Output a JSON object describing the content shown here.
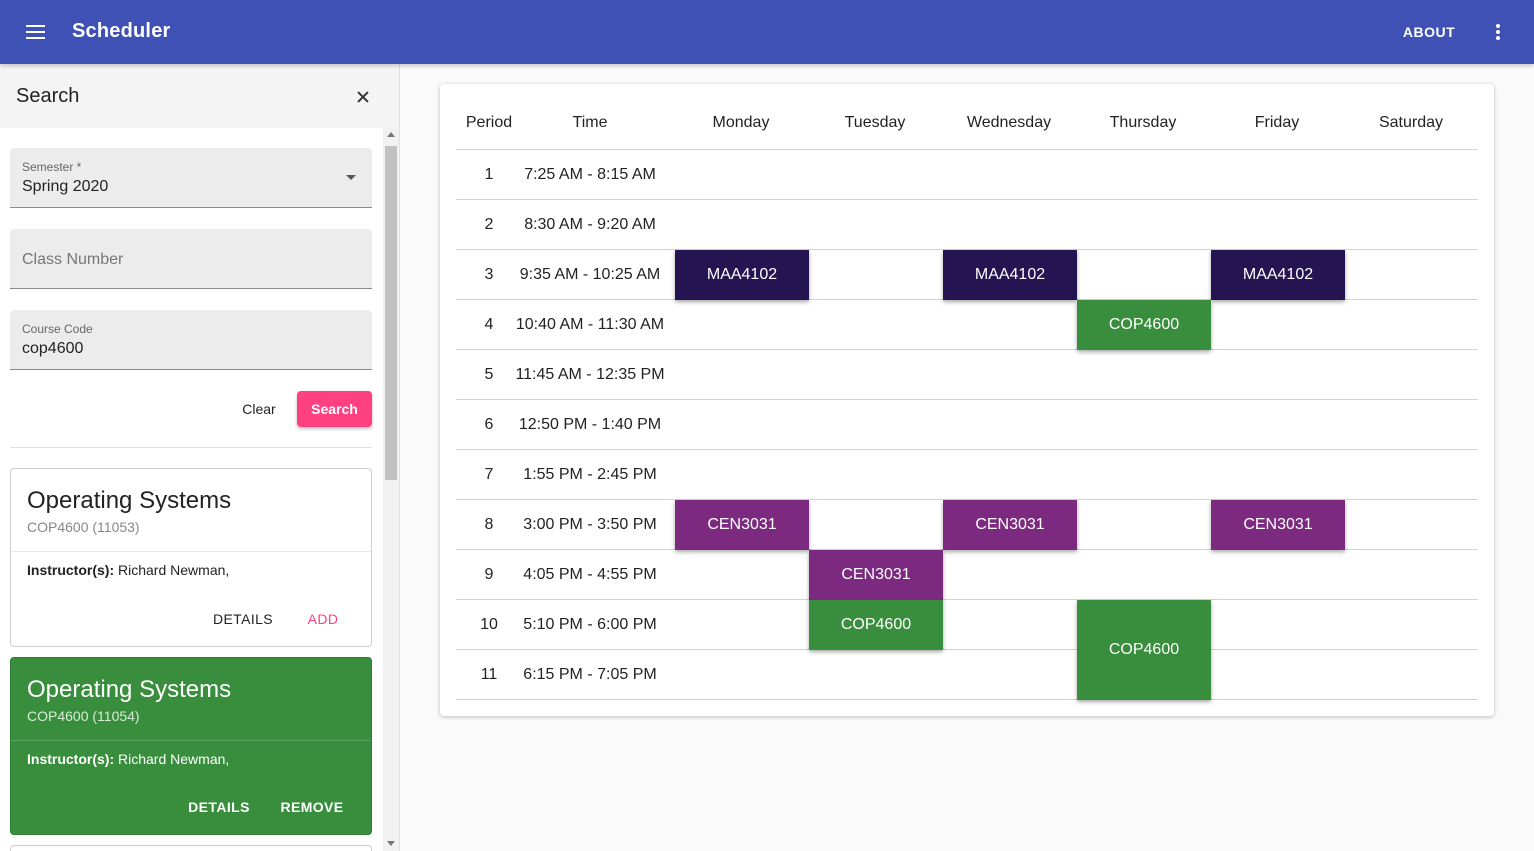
{
  "app": {
    "title": "Scheduler",
    "about_label": "ABOUT"
  },
  "sidebar": {
    "title": "Search",
    "semester": {
      "label": "Semester *",
      "value": "Spring 2020"
    },
    "class_number": {
      "placeholder": "Class Number"
    },
    "course_code": {
      "label": "Course Code",
      "value": "cop4600"
    },
    "clear_label": "Clear",
    "search_label": "Search",
    "results": [
      {
        "title": "Operating Systems",
        "code": "COP4600 (11053)",
        "instructor_label": "Instructor(s):",
        "instructor": " Richard Newman,",
        "details_label": "DETAILS",
        "action_label": "ADD"
      },
      {
        "title": "Operating Systems",
        "code": "COP4600 (11054)",
        "instructor_label": "Instructor(s):",
        "instructor": " Richard Newman,",
        "details_label": "DETAILS",
        "action_label": "REMOVE"
      }
    ]
  },
  "timetable": {
    "headers": [
      "Period",
      "Time",
      "Monday",
      "Tuesday",
      "Wednesday",
      "Thursday",
      "Friday",
      "Saturday"
    ],
    "periods": [
      {
        "period": "1",
        "time": "7:25 AM - 8:15 AM"
      },
      {
        "period": "2",
        "time": "8:30 AM - 9:20 AM"
      },
      {
        "period": "3",
        "time": "9:35 AM - 10:25 AM"
      },
      {
        "period": "4",
        "time": "10:40 AM - 11:30 AM"
      },
      {
        "period": "5",
        "time": "11:45 AM - 12:35 PM"
      },
      {
        "period": "6",
        "time": "12:50 PM - 1:40 PM"
      },
      {
        "period": "7",
        "time": "1:55 PM - 2:45 PM"
      },
      {
        "period": "8",
        "time": "3:00 PM - 3:50 PM"
      },
      {
        "period": "9",
        "time": "4:05 PM - 4:55 PM"
      },
      {
        "period": "10",
        "time": "5:10 PM - 6:00 PM"
      },
      {
        "period": "11",
        "time": "6:15 PM - 7:05 PM"
      }
    ],
    "blocks": [
      {
        "label": "MAA4102",
        "day": "Monday",
        "period": 3,
        "span": 1,
        "color": "#241552"
      },
      {
        "label": "MAA4102",
        "day": "Wednesday",
        "period": 3,
        "span": 1,
        "color": "#241552"
      },
      {
        "label": "MAA4102",
        "day": "Friday",
        "period": 3,
        "span": 1,
        "color": "#241552"
      },
      {
        "label": "COP4600",
        "day": "Thursday",
        "period": 4,
        "span": 1,
        "color": "#388e3c"
      },
      {
        "label": "CEN3031",
        "day": "Monday",
        "period": 8,
        "span": 1,
        "color": "#7b2a7f"
      },
      {
        "label": "CEN3031",
        "day": "Wednesday",
        "period": 8,
        "span": 1,
        "color": "#7b2a7f"
      },
      {
        "label": "CEN3031",
        "day": "Friday",
        "period": 8,
        "span": 1,
        "color": "#7b2a7f"
      },
      {
        "label": "CEN3031",
        "day": "Tuesday",
        "period": 9,
        "span": 1,
        "color": "#7b2a7f"
      },
      {
        "label": "COP4600",
        "day": "Tuesday",
        "period": 10,
        "span": 1,
        "color": "#388e3c"
      },
      {
        "label": "COP4600",
        "day": "Thursday",
        "period": 10,
        "span": 2,
        "color": "#388e3c"
      }
    ]
  },
  "colors": {
    "primary": "#3f51b5",
    "accent": "#ff4081",
    "added_course": "#388e3c"
  }
}
